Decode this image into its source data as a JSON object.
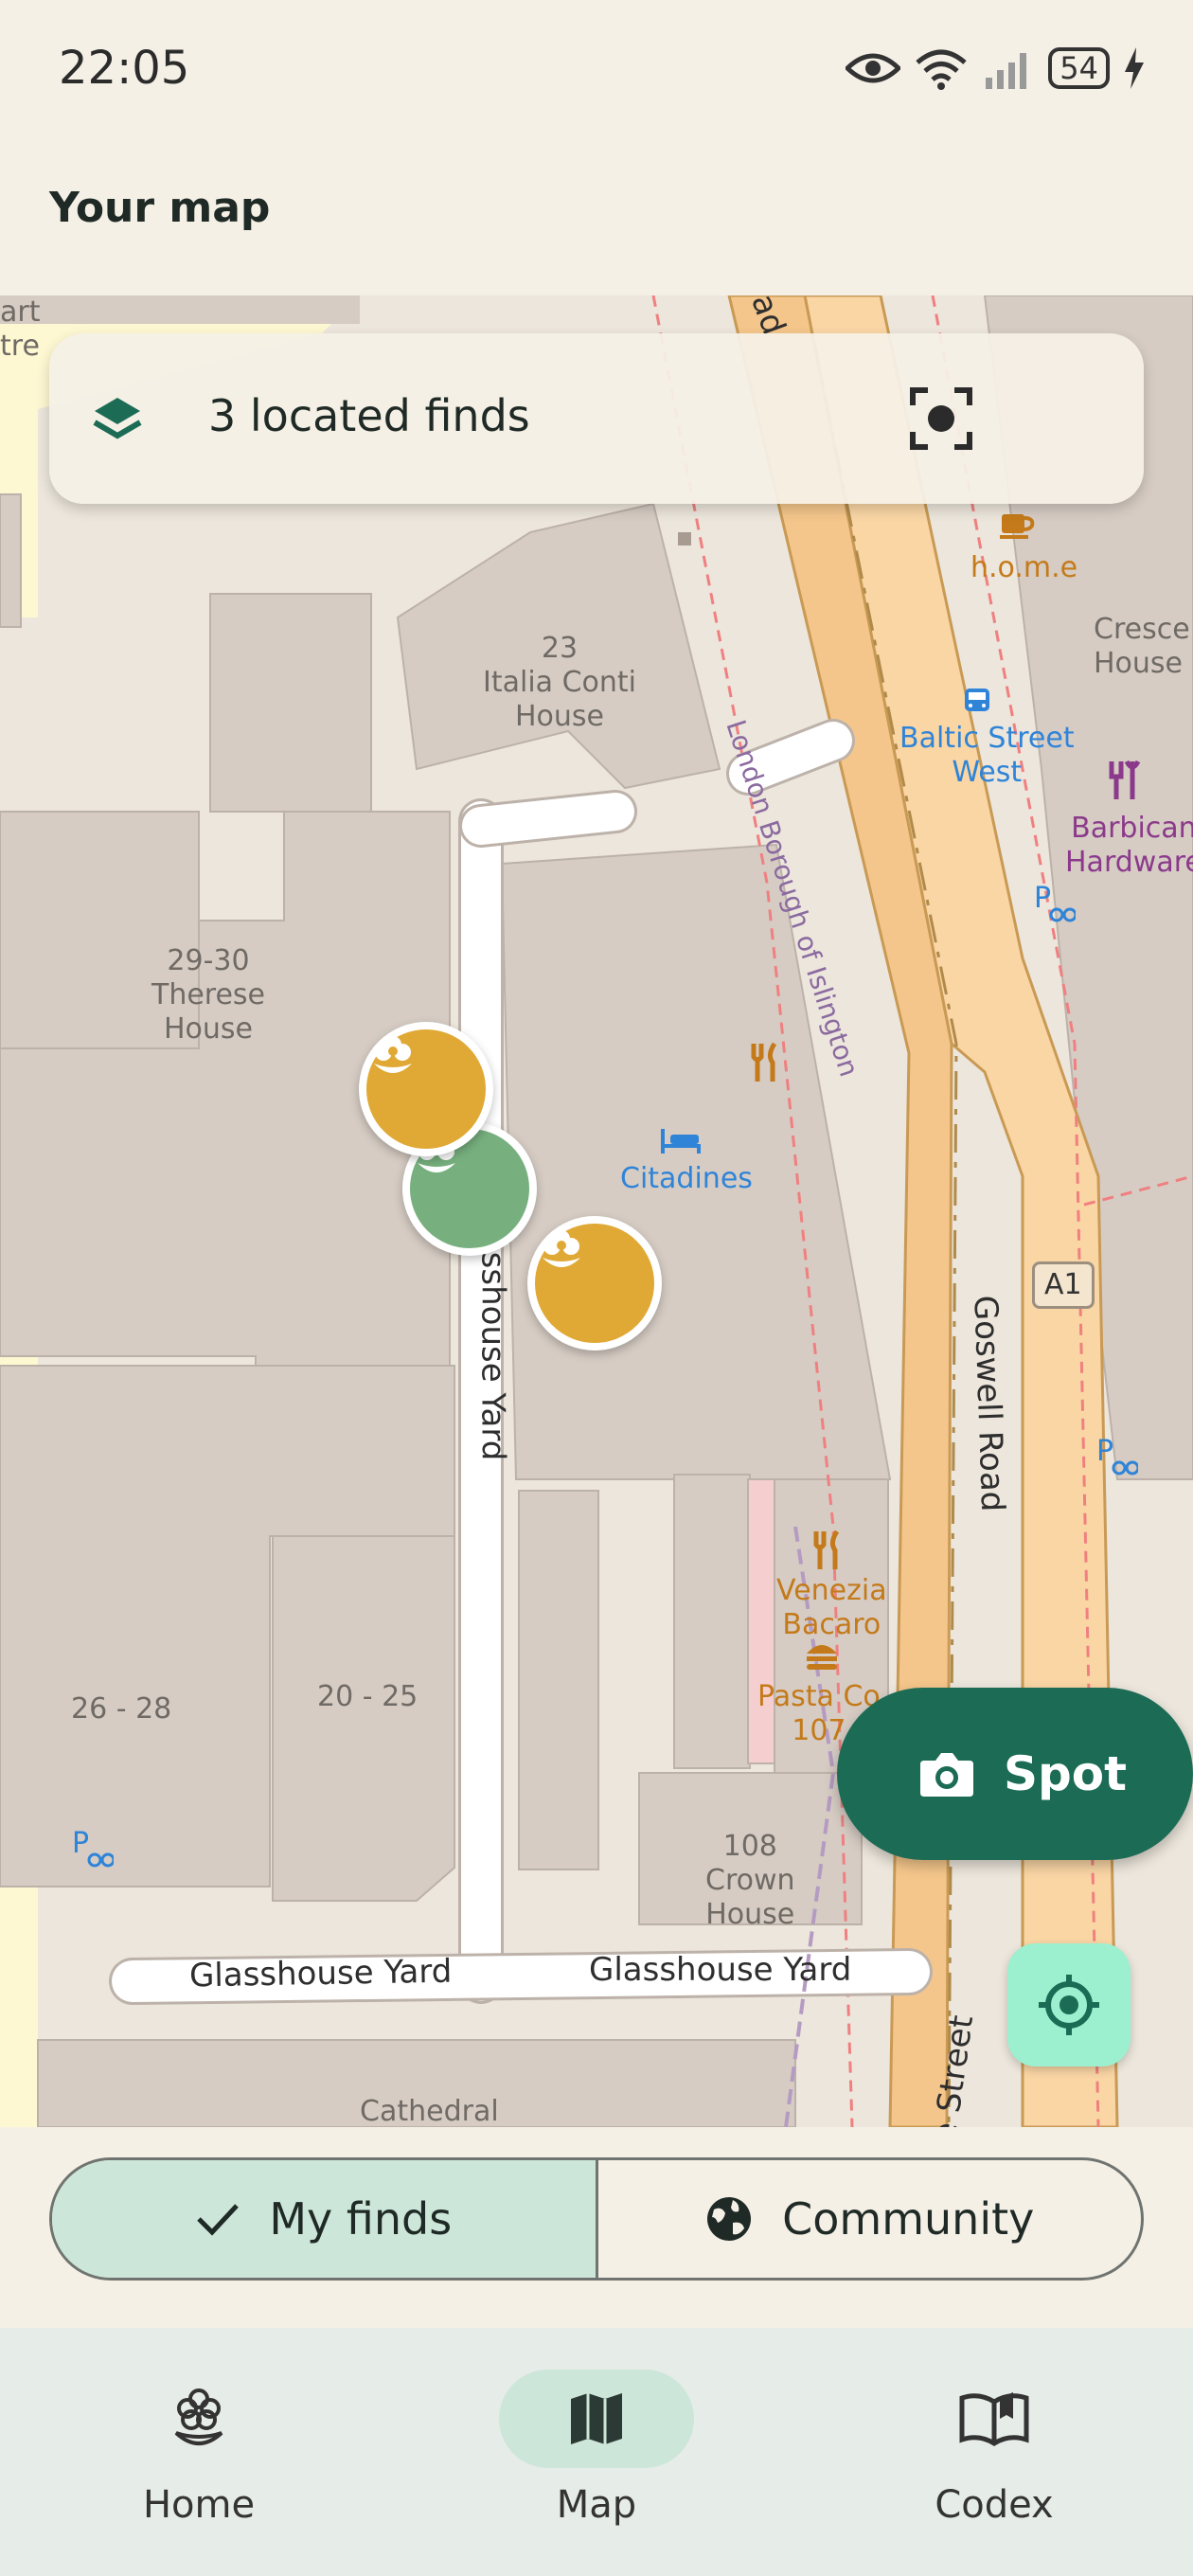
{
  "status_bar": {
    "time": "22:05",
    "battery": "54"
  },
  "header": {
    "title": "Your map"
  },
  "finds_card": {
    "label": "3 located finds"
  },
  "map": {
    "buildings": [
      "23\nItalia Conti\nHouse",
      "29-30\nTherese\nHouse",
      "26 - 28",
      "20 - 25",
      "108\nCrown\nHouse",
      "Cathedral"
    ],
    "pois": [
      "Baltic Street\nWest",
      "Barbican\nHardware",
      "Citadines",
      "Venezia\nBacaro",
      "h.o.m.e",
      "Cresce\nHouse",
      "Pasta Co\n107"
    ],
    "streets": [
      "London Borough of Islington",
      "Goswell Road",
      "sshouse Yard",
      "Glasshouse Yard",
      "Glasshouse Yard",
      "ate Street",
      "A1",
      "art\ntre",
      "ad"
    ]
  },
  "fab": {
    "spot_label": "Spot"
  },
  "segmented": {
    "my_finds": "My finds",
    "community": "Community"
  },
  "bottom_nav": {
    "home": "Home",
    "map": "Map",
    "codex": "Codex"
  },
  "colors": {
    "primary": "#1b6b55",
    "gold_marker": "#e0a935",
    "green_marker": "#77b07e",
    "active_pill": "#cde6da"
  }
}
